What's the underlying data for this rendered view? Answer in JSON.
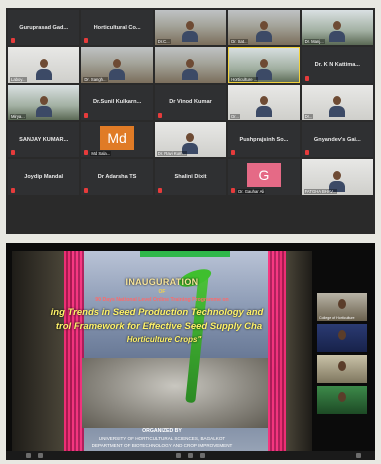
{
  "gallery": {
    "tiles": [
      {
        "label": "Guruprasad Gad...",
        "type": "name"
      },
      {
        "label": "Horticultural Co...",
        "type": "name"
      },
      {
        "label": "Dr.C...",
        "type": "cam",
        "style": "room"
      },
      {
        "label": "Dr. Sat...",
        "type": "cam",
        "style": "room"
      },
      {
        "label": "Dr. Manj...",
        "type": "cam",
        "style": "green"
      },
      {
        "label": "Laboy...",
        "type": "cam",
        "style": "light"
      },
      {
        "label": "Dr. Sangh...",
        "type": "cam",
        "style": "room"
      },
      {
        "label": "",
        "type": "cam",
        "style": "room"
      },
      {
        "label": "Horticulture ...",
        "type": "cam",
        "style": "green",
        "highlight": true
      },
      {
        "label": "Dr. K N Kattima...",
        "type": "name"
      },
      {
        "label": "Mirya...",
        "type": "cam",
        "style": "green"
      },
      {
        "label": "Dr.Sunil Kulkarn...",
        "type": "name"
      },
      {
        "label": "Dr Vinod Kumar",
        "type": "name"
      },
      {
        "label": "Dr...",
        "type": "cam",
        "style": "light"
      },
      {
        "label": "Dr...",
        "type": "cam",
        "style": "light"
      },
      {
        "label": "SANJAY KUMAR...",
        "type": "name"
      },
      {
        "label": "Md Sala...",
        "type": "avatar",
        "letter": "Md",
        "color": "#e07b26"
      },
      {
        "label": "Dr. Ravi Kum...",
        "type": "cam",
        "style": "light"
      },
      {
        "label": "Pushprajsinh So...",
        "type": "name"
      },
      {
        "label": "Gnyandev's Gai...",
        "type": "name"
      },
      {
        "label": "Joydip Mandal",
        "type": "name"
      },
      {
        "label": "Dr Adarsha TS",
        "type": "name"
      },
      {
        "label": "Shalini Dixit",
        "type": "name"
      },
      {
        "label": "Dr. Gauhar Ali",
        "type": "avatar",
        "letter": "G",
        "color": "#e56a86"
      },
      {
        "label": "FATGHA BHAV...",
        "type": "cam",
        "style": "light"
      }
    ]
  },
  "presentation": {
    "window_title": "Zoom",
    "title": "INAUGURATION",
    "of": "OF",
    "subtitle": "90 Days National Level Online Training Programme on",
    "line1": "ing Trends in Seed Production Technology and",
    "line2": "trol Framework for Effective Seed Supply Cha",
    "line3": "Horticulture Crops\"",
    "organizer1": "ORGANIZED BY",
    "organizer2": "UNIVERSITY OF HORTICULTURAL SCIENCES, BAGALKOT",
    "organizer3": "DEPARTMENT OF BIOTECHNOLOGY AND CROP IMPROVEMENT",
    "thumbnails": [
      {
        "label": "College of Horticulture",
        "style": "t-a"
      },
      {
        "label": "",
        "style": "t-b"
      },
      {
        "label": "",
        "style": "t-c"
      },
      {
        "label": "",
        "style": "t-d"
      }
    ]
  },
  "colors": {
    "mic_muted": "#e63b3b",
    "active_speaker": "#f2d23c",
    "slide_title": "#fff36a",
    "slide_accent": "#ff2a7a"
  }
}
